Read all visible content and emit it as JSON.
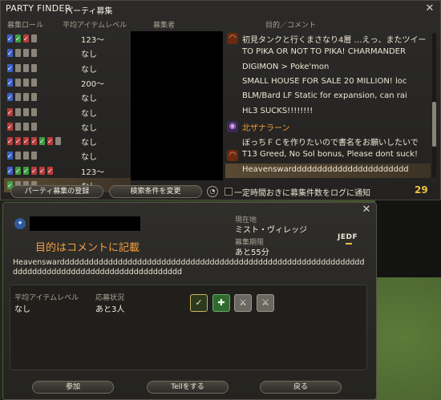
{
  "window": {
    "title_en": "PARTY FINDER",
    "title_jp": "パーティ募集",
    "close_icon": "close-x-icon"
  },
  "columns": {
    "role": "募集ロール",
    "avg_ilvl": "平均アイテムレベル",
    "recruiter": "募集者",
    "purpose": "目的／コメント"
  },
  "left_rows": [
    {
      "roles": [
        "tank",
        "heal",
        "dps",
        "open"
      ],
      "ilvl": "123〜"
    },
    {
      "roles": [
        "tank",
        "open",
        "open",
        "open"
      ],
      "ilvl": "なし"
    },
    {
      "roles": [
        "tank",
        "open",
        "open",
        "open"
      ],
      "ilvl": "なし"
    },
    {
      "roles": [
        "tank",
        "open",
        "open",
        "open"
      ],
      "ilvl": "200〜"
    },
    {
      "roles": [
        "tank",
        "open",
        "open",
        "open"
      ],
      "ilvl": "なし"
    },
    {
      "roles": [
        "dps",
        "open",
        "open",
        "open"
      ],
      "ilvl": "なし"
    },
    {
      "roles": [
        "dps",
        "open",
        "open",
        "open"
      ],
      "ilvl": "なし"
    },
    {
      "roles": [
        "dps",
        "dps",
        "dps",
        "dps",
        "heal",
        "dps",
        "open"
      ],
      "ilvl": "なし"
    },
    {
      "roles": [
        "tank",
        "open",
        "open",
        "open"
      ],
      "ilvl": "なし"
    },
    {
      "roles": [
        "tank",
        "heal",
        "heal",
        "dps",
        "dps",
        "dps"
      ],
      "ilvl": "123〜"
    },
    {
      "roles": [
        "heal",
        "open",
        "open",
        "open"
      ],
      "ilvl": "なし"
    }
  ],
  "comments": [
    {
      "icon": "dd",
      "text": "初見タンクと行くまさなり4層 …えっ、またツイー"
    },
    {
      "icon": "",
      "text": "TO PIKA OR NOT TO PIKA! CHARMANDER"
    },
    {
      "icon": "",
      "text": "DIGIMON > Poke'mon"
    },
    {
      "icon": "",
      "text": "SMALL HOUSE FOR SALE 20 MILLION! loc"
    },
    {
      "icon": "",
      "text": "BLM/Bard LF Static for expansion, can rai"
    },
    {
      "icon": "",
      "text": "HL3 SUCKS!!!!!!!!"
    },
    {
      "icon": "hunt",
      "text": "北ザナラーン",
      "orange": true
    },
    {
      "icon": "",
      "text": "ぼっちＦＣを作りたいので書名をお願いしたいで"
    },
    {
      "icon": "dd",
      "text": "T13 Greed, No Sol bonus, Please dont suck!"
    },
    {
      "icon": "",
      "text": "Heavenswarddddddddddddddddddddddd"
    }
  ],
  "toolbar": {
    "register_btn": "パーティ募集の登録",
    "search_btn": "検索条件を変更",
    "log_label": "一定時間おきに募集件数をログに通知",
    "count": "29"
  },
  "detail": {
    "purpose": "目的はコメントに記載",
    "location_label": "現在地",
    "location_value": "ミスト・ヴィレッジ",
    "time_label": "募集期限",
    "time_value": "あと55分",
    "lang": "JEDF",
    "comment": "Heavenswardddddddddddddddddddddddddddddddddddddddddddddddddddddddddddddddddddddddddddddddddddddddddddddddddd",
    "avg_label": "平均アイテムレベル",
    "avg_value": "なし",
    "status_label": "応募状況",
    "status_value": "あと3人",
    "slots": [
      "filled-dps",
      "heal",
      "dps",
      "dps"
    ],
    "btn_join": "参加",
    "btn_tell": "Tellをする",
    "btn_back": "戻る"
  }
}
